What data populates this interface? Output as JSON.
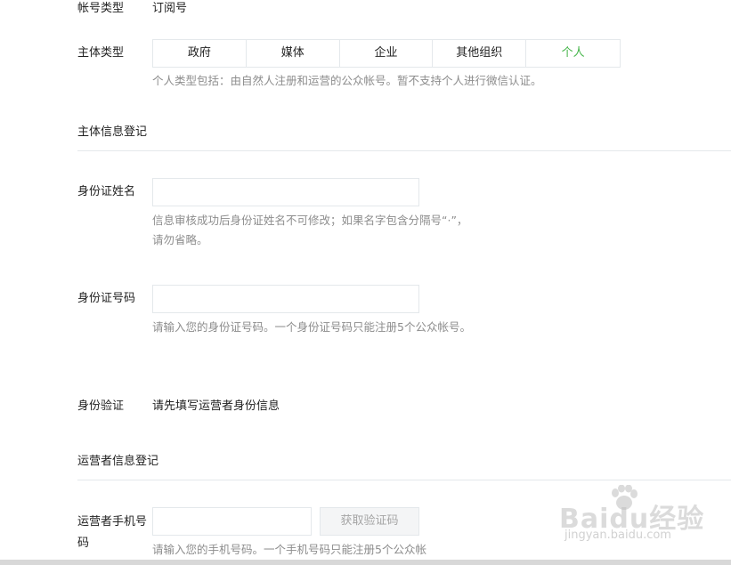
{
  "account_type": {
    "label": "帐号类型",
    "value": "订阅号"
  },
  "subject_type": {
    "label": "主体类型",
    "options": [
      "政府",
      "媒体",
      "企业",
      "其他组织",
      "个人"
    ],
    "selected": "个人",
    "hint": "个人类型包括：由自然人注册和运营的公众帐号。暂不支持个人进行微信认证。"
  },
  "subject_info_section": {
    "title": "主体信息登记"
  },
  "id_name": {
    "label": "身份证姓名",
    "value": "",
    "hint": "信息审核成功后身份证姓名不可修改；如果名字包含分隔号“·”，请勿省略。"
  },
  "id_number": {
    "label": "身份证号码",
    "value": "",
    "hint": "请输入您的身份证号码。一个身份证号码只能注册5个公众帐号。"
  },
  "identity_verification": {
    "label": "身份验证",
    "value": "请先填写运营者身份信息"
  },
  "operator_info_section": {
    "title": "运营者信息登记"
  },
  "operator_phone": {
    "label": "运营者手机号码",
    "value": "",
    "get_code_label": "获取验证码",
    "hint": "请输入您的手机号码。一个手机号码只能注册5个公众帐"
  },
  "watermark": {
    "logo_text": "Baidu经验",
    "url_text": "jingyan.baidu.com"
  },
  "colors": {
    "selected_option": "#44b549",
    "hint_text": "#8d8d8d",
    "border": "#e4e8eb",
    "disabled_button_bg": "#f4f5f6"
  }
}
